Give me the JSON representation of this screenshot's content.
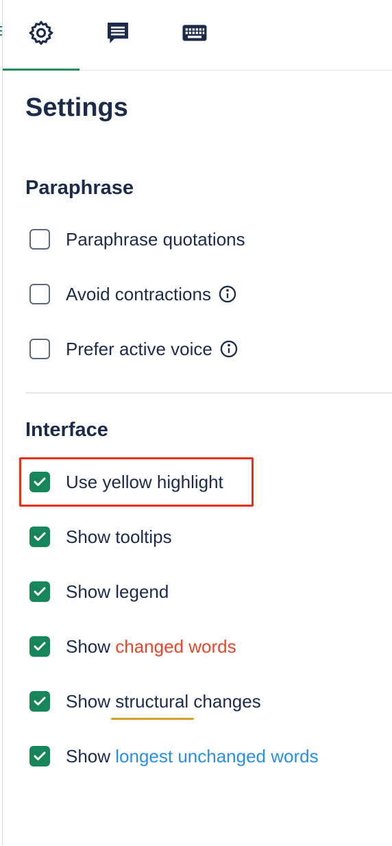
{
  "tabs": [
    {
      "icon": "gear-icon",
      "active": true
    },
    {
      "icon": "message-icon",
      "active": false
    },
    {
      "icon": "keyboard-icon",
      "active": false
    }
  ],
  "title": "Settings",
  "paraphrase": {
    "heading": "Paraphrase",
    "options": [
      {
        "label": "Paraphrase quotations",
        "checked": false
      },
      {
        "label": "Avoid contractions",
        "checked": false,
        "info": true
      },
      {
        "label": "Prefer active voice",
        "checked": false,
        "info": true
      }
    ]
  },
  "interface": {
    "heading": "Interface",
    "options": [
      {
        "label": "Use yellow highlight",
        "checked": true,
        "highlighted": true
      },
      {
        "label": "Show tooltips",
        "checked": true
      },
      {
        "label": "Show legend",
        "checked": true
      },
      {
        "prefix": "Show ",
        "accent": "changed words",
        "checked": true,
        "accent_color": "#e8452c"
      },
      {
        "prefix": "Show ",
        "accent": "structural",
        "suffix": " changes",
        "checked": true,
        "accent_color": "#d5a02a"
      },
      {
        "prefix": "Show ",
        "accent": "longest unchanged words",
        "checked": true,
        "accent_color": "#2a8ee6"
      }
    ]
  },
  "colors": {
    "check_green": "#16855a",
    "active_tab": "#1b8a5a",
    "highlight_border": "#e5321b"
  }
}
